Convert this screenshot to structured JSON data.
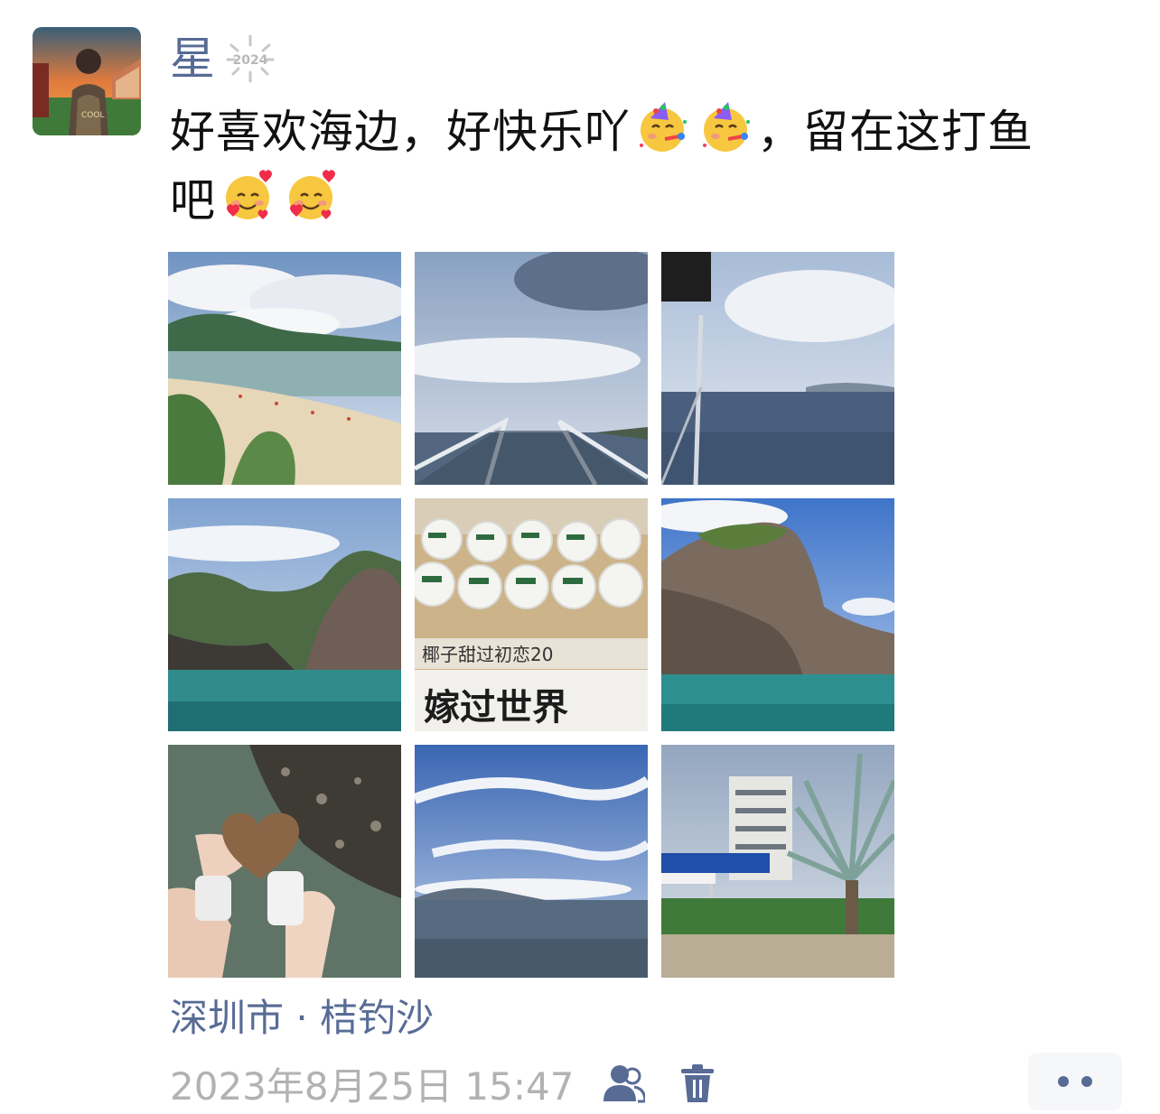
{
  "post": {
    "author": "星",
    "badge_text": "2024",
    "text_line1": "好喜欢海边，好快乐吖",
    "text_line1_after": "，留在这打鱼",
    "text_line2": "吧",
    "location": "深圳市 · 桔钓沙",
    "timestamp": "2023年8月25日 15:47"
  },
  "emojis": {
    "party": "partying-face",
    "love": "smiling-face-with-hearts"
  },
  "photos": [
    {
      "name": "photo-beach-bay"
    },
    {
      "name": "photo-boat-bow"
    },
    {
      "name": "photo-sea-flag-pole"
    },
    {
      "name": "photo-rocky-cliff"
    },
    {
      "name": "photo-coconuts-stall",
      "sign_text": "椰子甜过初恋20",
      "sign_text2": "嫁过世界"
    },
    {
      "name": "photo-rock-island"
    },
    {
      "name": "photo-heart-stone-feet"
    },
    {
      "name": "photo-sky-sea"
    },
    {
      "name": "photo-resort-palm"
    }
  ],
  "colors": {
    "link": "#576b95",
    "text": "#111111",
    "meta": "#b2b2b2"
  },
  "icons": {
    "visibility": "people-icon",
    "delete": "trash-icon",
    "more": "more-dots-icon"
  }
}
